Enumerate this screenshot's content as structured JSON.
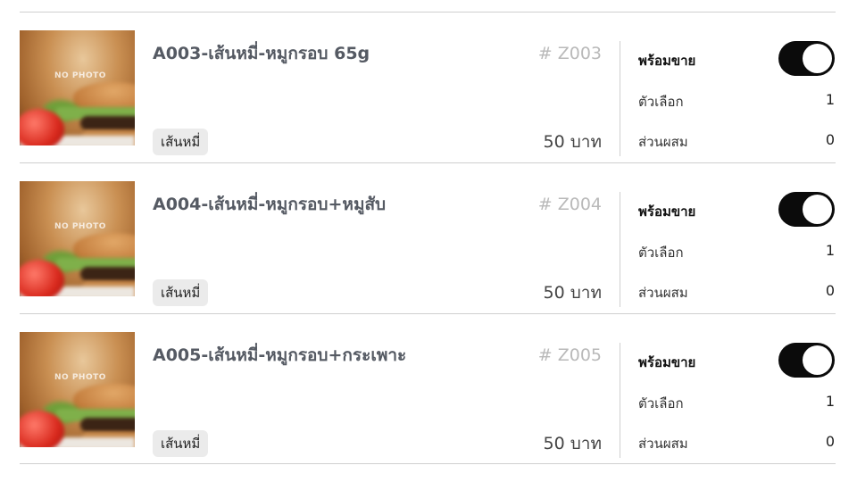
{
  "products": [
    {
      "title": "A003-เส้นหมี่-หมูกรอบ 65g",
      "code": "# Z003",
      "tag": "เส้นหมี่",
      "price": "50 บาท",
      "sale_label": "พร้อมขาย",
      "sale_on": true,
      "options_label": "ตัวเลือก",
      "options_value": "1",
      "mix_label": "ส่วนผสม",
      "mix_value": "0",
      "photo_placeholder": "NO PHOTO"
    },
    {
      "title": "A004-เส้นหมี่-หมูกรอบ+หมูสับ",
      "code": "# Z004",
      "tag": "เส้นหมี่",
      "price": "50 บาท",
      "sale_label": "พร้อมขาย",
      "sale_on": true,
      "options_label": "ตัวเลือก",
      "options_value": "1",
      "mix_label": "ส่วนผสม",
      "mix_value": "0",
      "photo_placeholder": "NO PHOTO"
    },
    {
      "title": "A005-เส้นหมี่-หมูกรอบ+กระเพาะ",
      "code": "# Z005",
      "tag": "เส้นหมี่",
      "price": "50 บาท",
      "sale_label": "พร้อมขาย",
      "sale_on": true,
      "options_label": "ตัวเลือก",
      "options_value": "1",
      "mix_label": "ส่วนผสม",
      "mix_value": "0",
      "photo_placeholder": "NO PHOTO"
    }
  ],
  "colors": {
    "toggle_on": "#0b0b0b",
    "title_text": "#555a63",
    "code_text": "#b9b9b9",
    "tag_bg": "#ebebeb",
    "divider": "#cfcfcf"
  }
}
